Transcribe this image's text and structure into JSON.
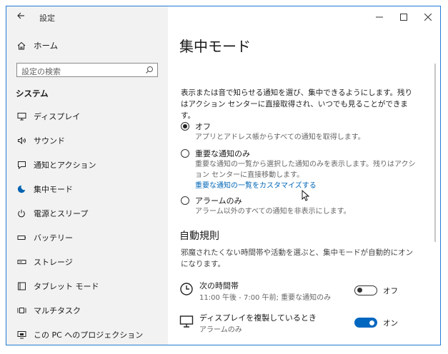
{
  "window": {
    "title": "設定"
  },
  "sidebar": {
    "home_label": "ホーム",
    "search_placeholder": "設定の検索",
    "section_title": "システム",
    "items": [
      {
        "label": "ディスプレイ",
        "icon": "monitor-icon"
      },
      {
        "label": "サウンド",
        "icon": "speaker-icon"
      },
      {
        "label": "通知とアクション",
        "icon": "notification-icon"
      },
      {
        "label": "集中モード",
        "icon": "moon-icon",
        "active": true
      },
      {
        "label": "電源とスリープ",
        "icon": "power-icon"
      },
      {
        "label": "バッテリー",
        "icon": "battery-icon"
      },
      {
        "label": "ストレージ",
        "icon": "storage-icon"
      },
      {
        "label": "タブレット モード",
        "icon": "tablet-icon"
      },
      {
        "label": "マルチタスク",
        "icon": "multitask-icon"
      },
      {
        "label": "この PC へのプロジェクション",
        "icon": "projection-icon"
      }
    ]
  },
  "main": {
    "title": "集中モード",
    "description": "表示または音で知らせる通知を選び、集中できるようにします。残りはアクション センターに直接取得され、いつでも見ることができます。",
    "options": [
      {
        "name": "オフ",
        "sub": "アプリとアドレス帳からすべての通知を取得します。",
        "selected": true
      },
      {
        "name": "重要な通知のみ",
        "sub": "重要な通知の一覧から選択した通知のみを表示します。残りはアクション センターに直接移動します。",
        "link": "重要な通知の一覧をカスタマイズする",
        "selected": false
      },
      {
        "name": "アラームのみ",
        "sub": "アラーム以外のすべての通知を非表示にします。",
        "selected": false
      }
    ],
    "rules_heading": "自動規則",
    "rules_description": "邪魔されたくない時間帯や活動を選ぶと、集中モードが自動的にオンになります。",
    "rules": [
      {
        "title": "次の時間帯",
        "sub": "11:00 午後 - 7:00 午前; 重要な通知のみ",
        "state": "オフ",
        "on": false,
        "icon": "clock-icon"
      },
      {
        "title": "ディスプレイを複製しているとき",
        "sub": "アラームのみ",
        "state": "オン",
        "on": true,
        "icon": "display-duplicate-icon"
      }
    ]
  },
  "colors": {
    "accent": "#0067c0",
    "link": "#0067b8",
    "sidebar_bg": "#f2f2f2",
    "window_border": "#1f7bd6"
  }
}
